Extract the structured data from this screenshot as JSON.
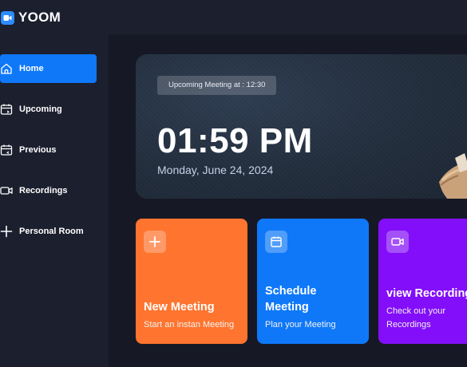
{
  "app": {
    "name": "YOOM"
  },
  "sidebar": {
    "items": [
      {
        "label": "Home",
        "icon": "home-icon",
        "active": true
      },
      {
        "label": "Upcoming",
        "icon": "calendar-upcoming-icon",
        "active": false
      },
      {
        "label": "Previous",
        "icon": "calendar-previous-icon",
        "active": false
      },
      {
        "label": "Recordings",
        "icon": "video-icon",
        "active": false
      },
      {
        "label": "Personal Room",
        "icon": "plus-icon",
        "active": false
      }
    ]
  },
  "hero": {
    "badge": "Upcoming Meeting at : 12:30",
    "time": "01:59 PM",
    "date": "Monday, June 24, 2024"
  },
  "cards": [
    {
      "title": "New Meeting",
      "subtitle": "Start an instan Meeting",
      "icon": "plus-icon",
      "color": "#ff742e"
    },
    {
      "title": "Schedule Meeting",
      "subtitle": "Plan your Meeting",
      "icon": "calendar-icon",
      "color": "#0e78f9"
    },
    {
      "title": "view Recordings",
      "subtitle": "Check out your Recordings",
      "icon": "video-icon",
      "color": "#830ef9"
    }
  ],
  "colors": {
    "active_nav": "#0e78f9",
    "background": "#1c1f2e",
    "main_background": "#161925"
  }
}
